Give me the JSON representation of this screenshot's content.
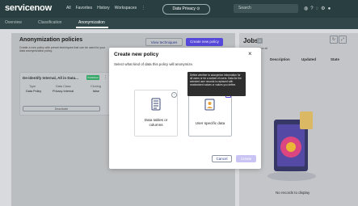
{
  "topbar": {
    "logo": "servicenow",
    "nav": [
      "All",
      "Favorites",
      "History",
      "Workspaces",
      "⋮"
    ],
    "scope_pill": "Data Privacy ⊙",
    "search_placeholder": "Search",
    "icons": [
      "globe-icon",
      "help-icon",
      "bell-icon",
      "settings-icon",
      "avatar"
    ]
  },
  "subnav": {
    "tabs": [
      "Overview",
      "Classification",
      "Anonymization"
    ],
    "active": "Anonymization"
  },
  "left": {
    "title": "Anonymization policies",
    "desc": "Create a new policy with preset techniques that can be used for your data anonymization policy.",
    "view_techniques": "View techniques",
    "create_new": "Create new policy",
    "card_title": "De-identify Internal, All in Data...",
    "card_badge": "Published",
    "columns": [
      {
        "h": "Type",
        "v": "Data Policy"
      },
      {
        "h": "Data Class",
        "v": "Privacy Internal"
      },
      {
        "h": "Cloning",
        "v": "false"
      }
    ],
    "card_action": "Deactivate"
  },
  "right": {
    "title": "Jobs",
    "count": "0",
    "sub": "View all",
    "headers": [
      "Description",
      "Updated",
      "State"
    ],
    "empty": "No records to display"
  },
  "modal": {
    "title": "Create new policy",
    "subtitle": "Select what kind of data this policy will anonymize.",
    "options": [
      {
        "label": "Data tables or columns"
      },
      {
        "label": "User specific data"
      }
    ],
    "tooltip": "Define whether to anonymize information for all users or for a subset of users. Data for the selected user records is replaced with randomized values or values you define.",
    "cancel": "Cancel",
    "create": "Create"
  },
  "colors": {
    "topbar": "#293e40",
    "primary": "#5b4de8",
    "badge": "#3cb371"
  }
}
